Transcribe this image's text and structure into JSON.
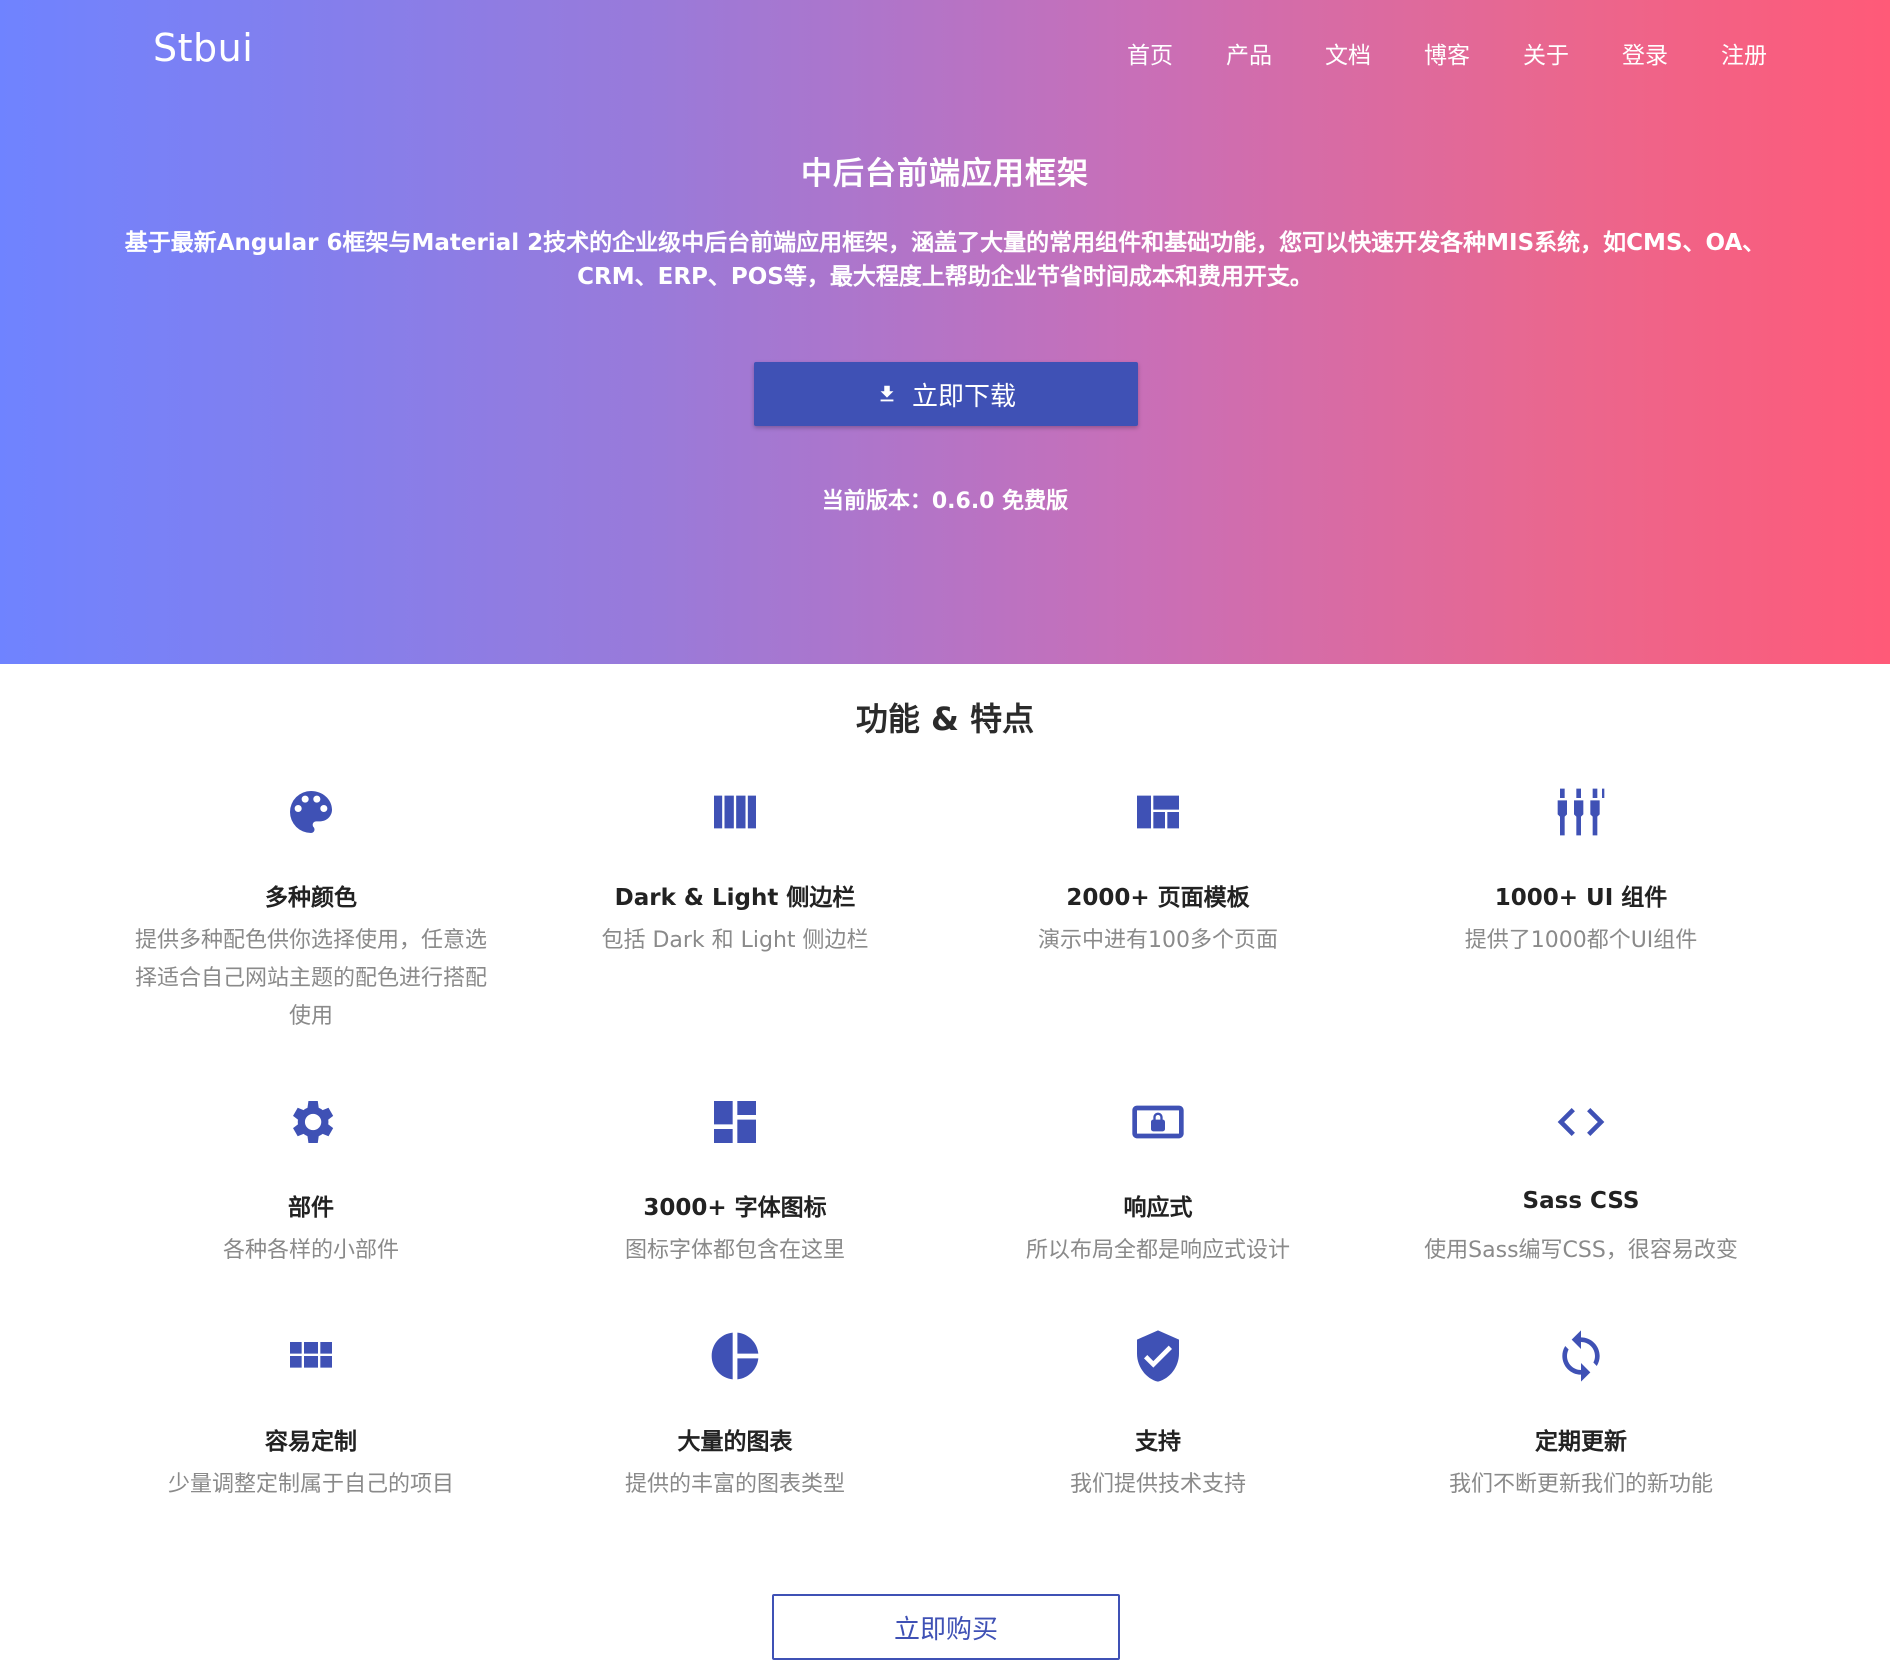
{
  "header": {
    "brand": "Stbui",
    "nav": [
      "首页",
      "产品",
      "文档",
      "博客",
      "关于",
      "登录",
      "注册"
    ]
  },
  "hero": {
    "title": "中后台前端应用框架",
    "description": "基于最新Angular 6框架与Material 2技术的企业级中后台前端应用框架，涵盖了大量的常用组件和基础功能，您可以快速开发各种MIS系统，如CMS、OA、CRM、ERP、POS等，最大程度上帮助企业节省时间成本和费用开支。",
    "download_label": "立即下载",
    "version": "当前版本：0.6.0 免费版"
  },
  "features": {
    "title": "功能 & 特点",
    "items": [
      {
        "icon": "palette-icon",
        "title": "多种颜色",
        "desc": "提供多种配色供你选择使用，任意选择适合自己网站主题的配色进行搭配使用"
      },
      {
        "icon": "view-column-icon",
        "title": "Dark & Light 侧边栏",
        "desc": "包括 Dark 和 Light 侧边栏"
      },
      {
        "icon": "view-quilt-icon",
        "title": "2000+ 页面模板",
        "desc": "演示中进有100多个页面"
      },
      {
        "icon": "settings-input-component-icon",
        "title": "1000+ UI 组件",
        "desc": "提供了1000都个UI组件"
      },
      {
        "icon": "gear-icon",
        "title": "部件",
        "desc": "各种各样的小部件"
      },
      {
        "icon": "dashboard-icon",
        "title": "3000+ 字体图标",
        "desc": "图标字体都包含在这里"
      },
      {
        "icon": "screen-lock-icon",
        "title": "响应式",
        "desc": "所以布局全都是响应式设计"
      },
      {
        "icon": "code-icon",
        "title": "Sass CSS",
        "desc": "使用Sass编写CSS，很容易改变"
      },
      {
        "icon": "view-module-icon",
        "title": "容易定制",
        "desc": "少量调整定制属于自己的项目"
      },
      {
        "icon": "pie-chart-icon",
        "title": "大量的图表",
        "desc": "提供的丰富的图表类型"
      },
      {
        "icon": "shield-check-icon",
        "title": "支持",
        "desc": "我们提供技术支持"
      },
      {
        "icon": "sync-icon",
        "title": "定期更新",
        "desc": "我们不断更新我们的新功能"
      }
    ]
  },
  "buy_label": "立即购买",
  "colors": {
    "primary": "#3f51b5",
    "gradient_start": "#6f83ff",
    "gradient_end": "#ff5a78",
    "text_muted": "#8a8a8a"
  }
}
